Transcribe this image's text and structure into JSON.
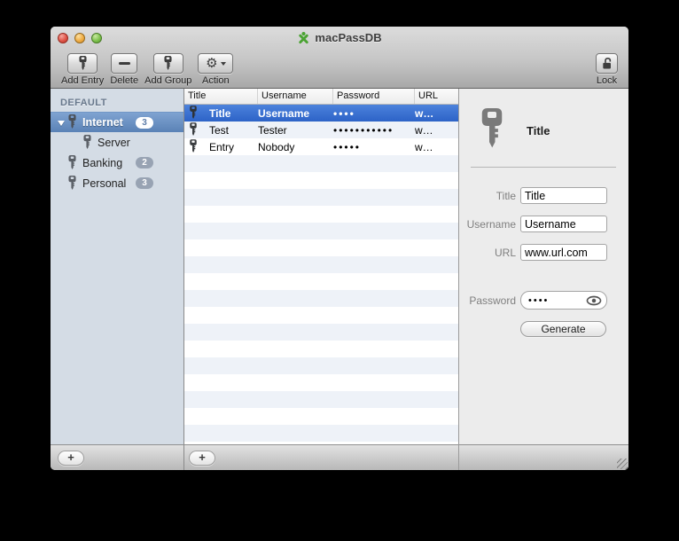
{
  "window": {
    "title": "macPassDB"
  },
  "toolbar": {
    "items": [
      {
        "id": "add-entry",
        "label": "Add Entry",
        "icon": "key-icon"
      },
      {
        "id": "delete",
        "label": "Delete",
        "icon": "minus-icon"
      },
      {
        "id": "add-group",
        "label": "Add Group",
        "icon": "key-icon"
      },
      {
        "id": "action",
        "label": "Action",
        "icon": "gear-icon"
      },
      {
        "id": "lock",
        "label": "Lock",
        "icon": "padlock-icon"
      }
    ],
    "gear_glyph": "⚙"
  },
  "sidebar": {
    "section_label": "DEFAULT",
    "items": [
      {
        "id": "internet",
        "label": "Internet",
        "badge": "3",
        "selected": true,
        "expanded": true,
        "indent": 0
      },
      {
        "id": "server",
        "label": "Server",
        "badge": null,
        "selected": false,
        "expanded": false,
        "indent": 1
      },
      {
        "id": "banking",
        "label": "Banking",
        "badge": "2",
        "selected": false,
        "expanded": false,
        "indent": 0
      },
      {
        "id": "personal",
        "label": "Personal",
        "badge": "3",
        "selected": false,
        "expanded": false,
        "indent": 0
      }
    ],
    "add_button_label": "+"
  },
  "table": {
    "columns": [
      "Title",
      "Username",
      "Password",
      "URL"
    ],
    "rows": [
      {
        "title": "Title",
        "username": "Username",
        "password_dots": "••••",
        "url": "w…",
        "selected": true
      },
      {
        "title": "Test",
        "username": "Tester",
        "password_dots": "•••••••••••",
        "url": "w…",
        "selected": false
      },
      {
        "title": "Entry",
        "username": "Nobody",
        "password_dots": "•••••",
        "url": "w…",
        "selected": false
      }
    ],
    "add_button_label": "+"
  },
  "detail": {
    "heading": "Title",
    "fields": {
      "title": {
        "label": "Title",
        "value": "Title"
      },
      "username": {
        "label": "Username",
        "value": "Username"
      },
      "url": {
        "label": "URL",
        "value": "www.url.com"
      },
      "password": {
        "label": "Password",
        "value": "••••"
      }
    },
    "generate_label": "Generate"
  },
  "colors": {
    "accent_selection_blue": "#2d63c7",
    "sidebar_selection_blue": "#5a82b6",
    "sidebar_bg": "#d4dce5",
    "app_icon_green": "#4aa332",
    "stripe_blue": "#eef2f8"
  }
}
